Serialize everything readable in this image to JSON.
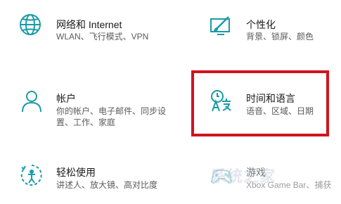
{
  "accent_color": "#1a9ba8",
  "highlight_color": "#d0141d",
  "tiles": [
    {
      "icon": "globe-icon",
      "title": "网络和 Internet",
      "desc": "WLAN、飞行模式、VPN"
    },
    {
      "icon": "personalization-icon",
      "title": "个性化",
      "desc": "背景、锁屏、颜色"
    },
    {
      "icon": "person-icon",
      "title": "帐户",
      "desc": "你的帐户、电子邮件、同步设置、工作、家庭"
    },
    {
      "icon": "time-language-icon",
      "title": "时间和语言",
      "desc": "语音、区域、日期"
    },
    {
      "icon": "ease-of-access-icon",
      "title": "轻松使用",
      "desc": "讲述人、放大镜、高对比度"
    },
    {
      "icon": "gaming-icon",
      "title": "游戏",
      "desc": "Xbox Game Bar、捕获"
    }
  ],
  "watermark": "系统之家"
}
